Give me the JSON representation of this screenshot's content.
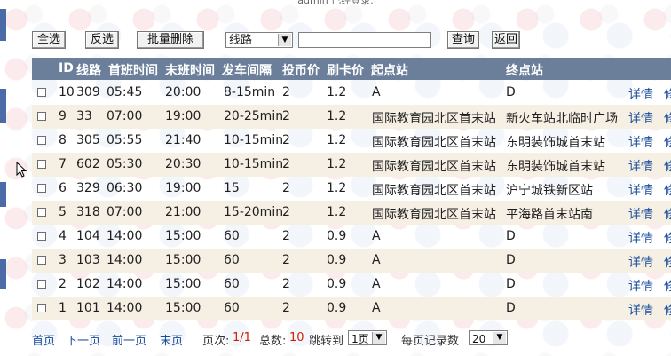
{
  "top_text": "admin 已经登录.",
  "toolbar": {
    "select_all": "全选",
    "invert": "反选",
    "batch_delete": "批量删除",
    "filter_field": "线路",
    "search_value": "",
    "query": "查询",
    "back": "返回"
  },
  "columns": [
    "ID",
    "线路",
    "首班时间",
    "末班时间",
    "发车间隔",
    "投币价",
    "刷卡价",
    "起点站",
    "终点站"
  ],
  "rows": [
    {
      "id": "10",
      "line": "309",
      "first": "05:45",
      "last": "20:00",
      "interval": "8-15min",
      "coin": "2",
      "card": "1.2",
      "start": "A",
      "end": "D"
    },
    {
      "id": "9",
      "line": "33",
      "first": "07:00",
      "last": "19:00",
      "interval": "20-25min",
      "coin": "2",
      "card": "1.2",
      "start": "国际教育园北区首末站",
      "end": "新火车站北临时广场"
    },
    {
      "id": "8",
      "line": "305",
      "first": "05:55",
      "last": "21:40",
      "interval": "10-15min",
      "coin": "2",
      "card": "1.2",
      "start": "国际教育园北区首末站",
      "end": "东明装饰城首末站"
    },
    {
      "id": "7",
      "line": "602",
      "first": "05:30",
      "last": "20:30",
      "interval": "10-15min",
      "coin": "2",
      "card": "1.2",
      "start": "国际教育园北区首末站",
      "end": "东明装饰城首末站"
    },
    {
      "id": "6",
      "line": "329",
      "first": "06:30",
      "last": "19:00",
      "interval": "15",
      "coin": "2",
      "card": "1.2",
      "start": "国际教育园北区首末站",
      "end": "沪宁城铁新区站"
    },
    {
      "id": "5",
      "line": "318",
      "first": "07:00",
      "last": "21:00",
      "interval": "15-20min",
      "coin": "2",
      "card": "1.2",
      "start": "国际教育园北区首末站",
      "end": "平海路首末站南"
    },
    {
      "id": "4",
      "line": "104",
      "first": "14:00",
      "last": "15:00",
      "interval": "60",
      "coin": "2",
      "card": "0.9",
      "start": "A",
      "end": "D"
    },
    {
      "id": "3",
      "line": "103",
      "first": "14:00",
      "last": "15:00",
      "interval": "60",
      "coin": "2",
      "card": "0.9",
      "start": "A",
      "end": "D"
    },
    {
      "id": "2",
      "line": "102",
      "first": "14:00",
      "last": "15:00",
      "interval": "60",
      "coin": "2",
      "card": "0.9",
      "start": "A",
      "end": "D"
    },
    {
      "id": "1",
      "line": "101",
      "first": "14:00",
      "last": "15:00",
      "interval": "60",
      "coin": "2",
      "card": "0.9",
      "start": "A",
      "end": "D"
    }
  ],
  "row_actions": {
    "detail": "详情",
    "edit": "修"
  },
  "pager": {
    "first": "首页",
    "next": "下一页",
    "prev": "前一页",
    "last": "末页",
    "page_label": "页次:",
    "page_value": "1/1",
    "total_label": "总数:",
    "total_value": "10",
    "jump_label": "跳转到",
    "jump_value": "1页",
    "per_page_label": "每页记录数",
    "per_page_value": "20"
  },
  "colors": {
    "header_bg": "#6b7f9b",
    "link": "#1a4d9c",
    "row_alt": "#f5efe4",
    "accent_red": "#cc2200"
  }
}
